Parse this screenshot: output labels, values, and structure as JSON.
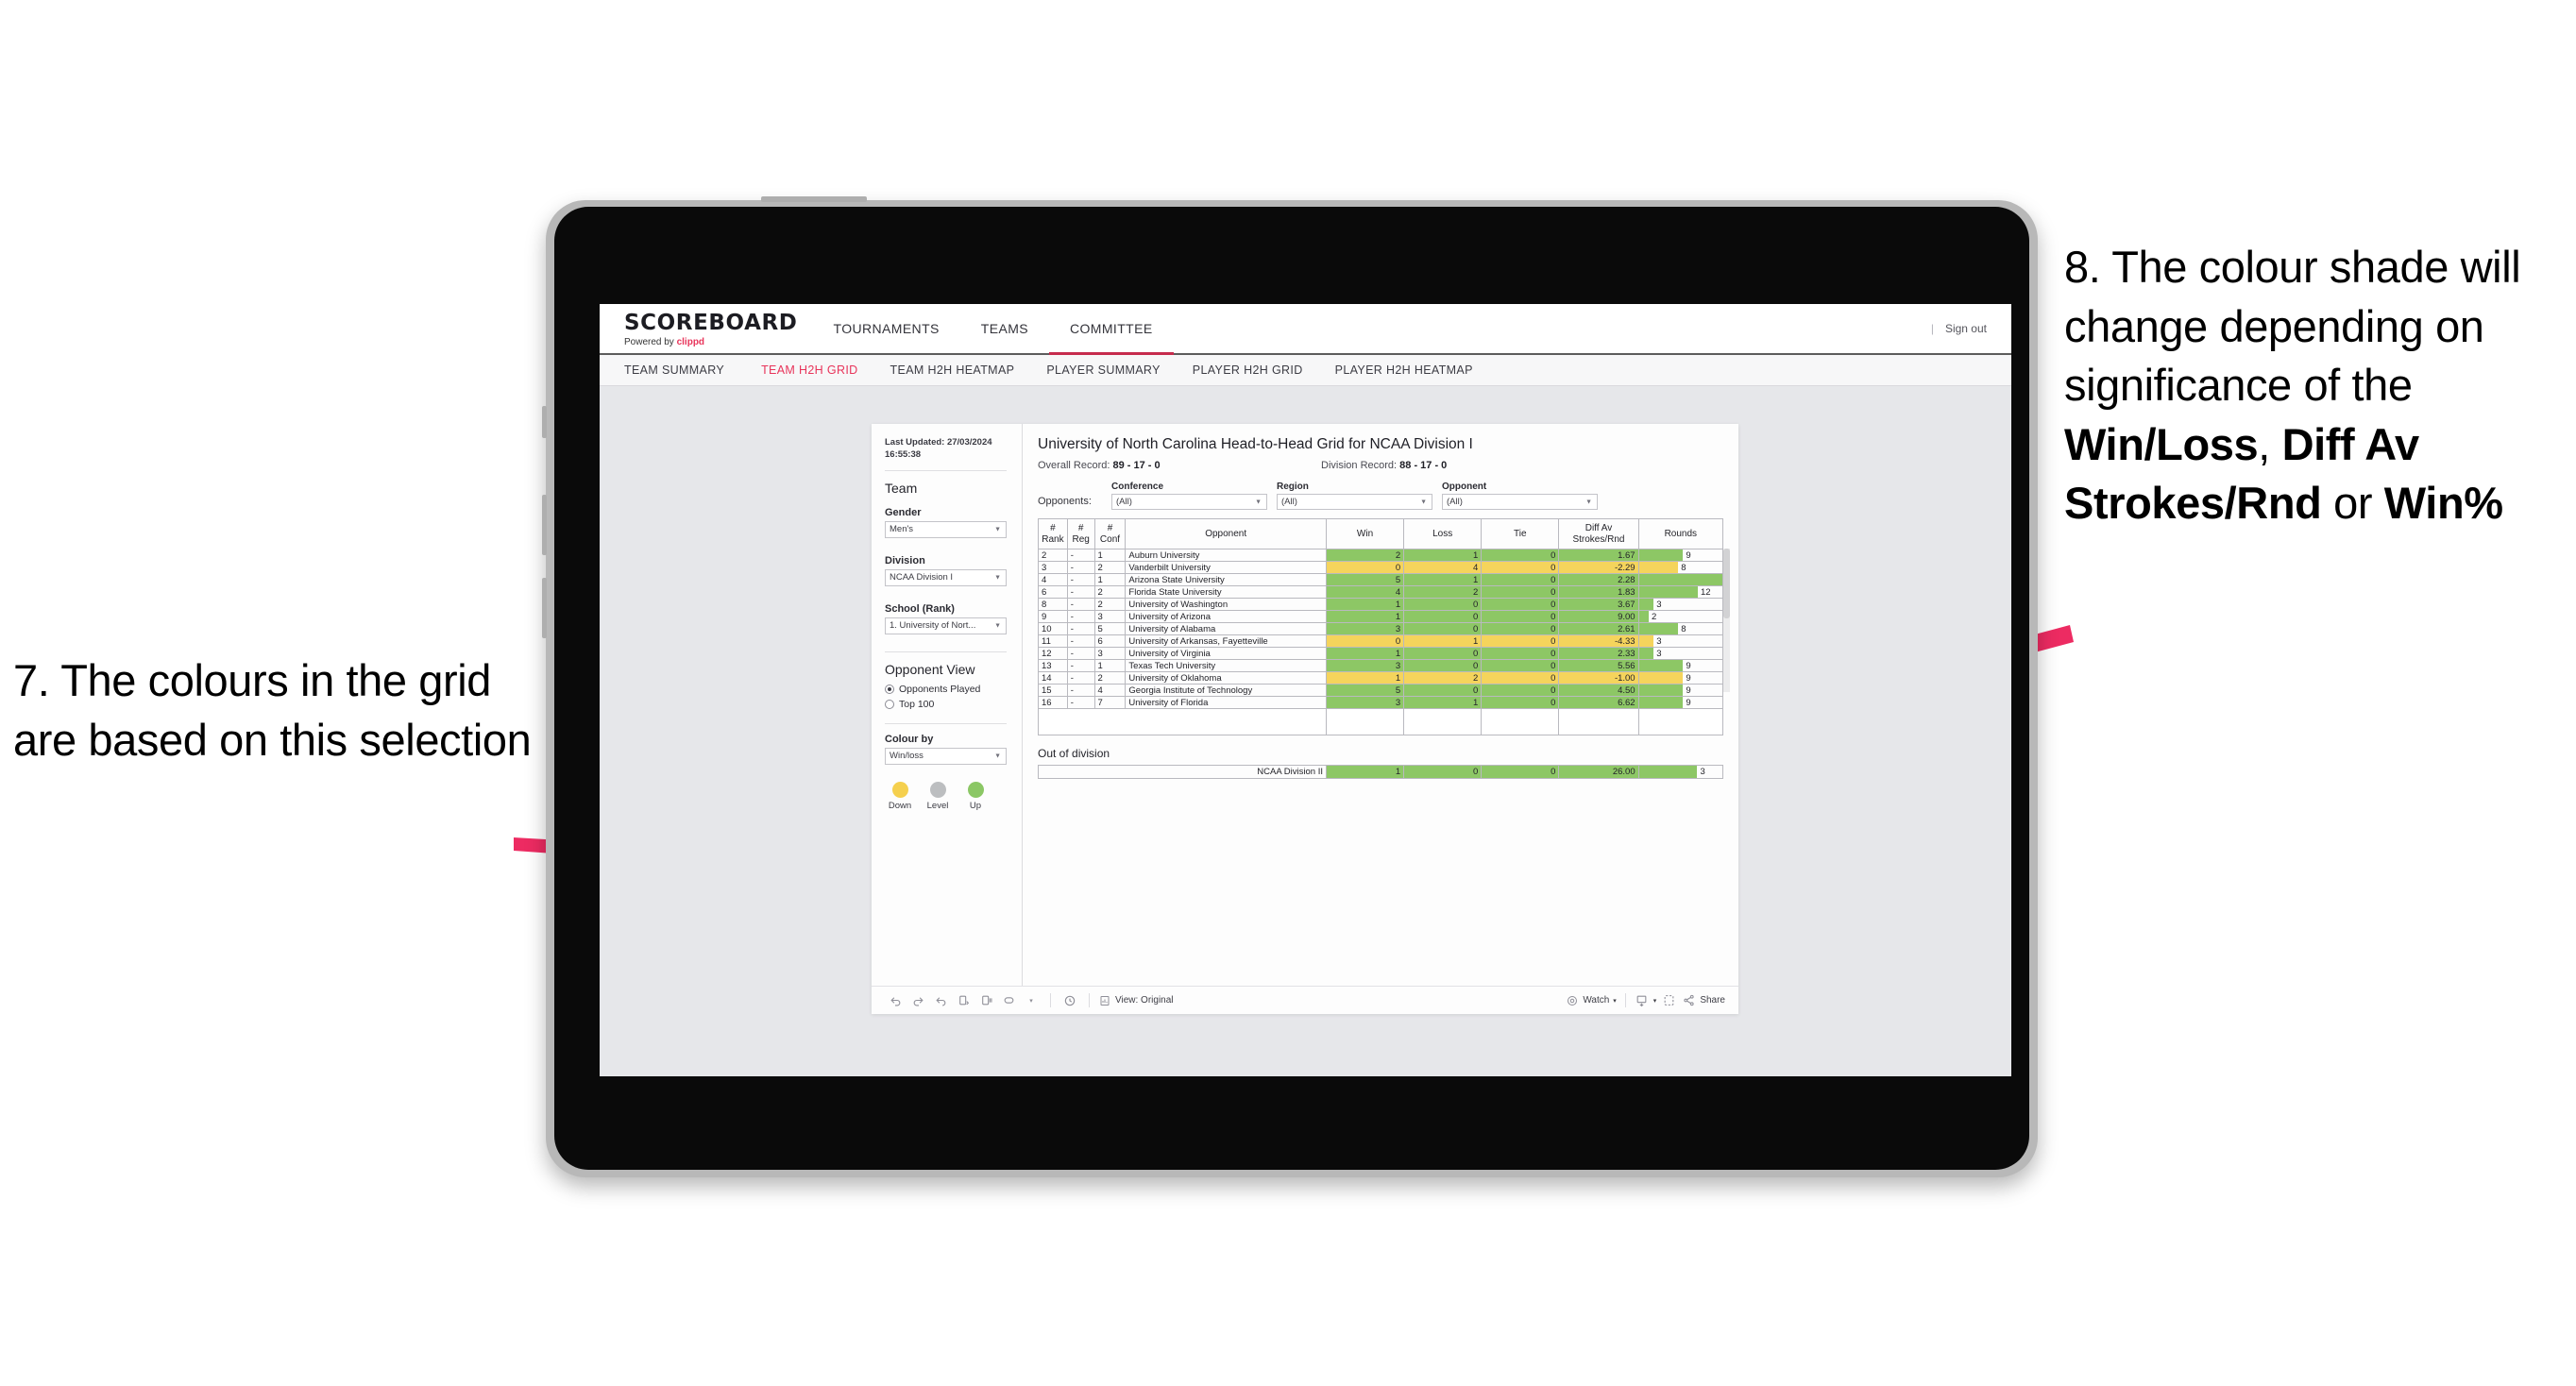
{
  "annotations": {
    "left": {
      "number": "7.",
      "text": "7. The colours in the grid are based on this selection"
    },
    "right": {
      "segments": [
        {
          "text": "8. The colour shade will change depending on significance of the ",
          "bold": false
        },
        {
          "text": "Win/Loss",
          "bold": true
        },
        {
          "text": ", ",
          "bold": false
        },
        {
          "text": "Diff Av Strokes/Rnd",
          "bold": true
        },
        {
          "text": " or ",
          "bold": false
        },
        {
          "text": "Win%",
          "bold": true
        }
      ]
    },
    "arrow_color": "#ED2B62"
  },
  "navbar": {
    "brand_title": "SCOREBOARD",
    "brand_powered": "Powered by",
    "brand_name": "clippd",
    "tabs": [
      {
        "label": "TOURNAMENTS",
        "active": false
      },
      {
        "label": "TEAMS",
        "active": false
      },
      {
        "label": "COMMITTEE",
        "active": true
      }
    ],
    "separator": "|",
    "sign_out": "Sign out"
  },
  "subnav": {
    "tabs": [
      {
        "label": "TEAM SUMMARY",
        "active": false
      },
      {
        "label": "TEAM H2H GRID",
        "active": true
      },
      {
        "label": "TEAM H2H HEATMAP",
        "active": false
      },
      {
        "label": "PLAYER SUMMARY",
        "active": false
      },
      {
        "label": "PLAYER H2H GRID",
        "active": false
      },
      {
        "label": "PLAYER H2H HEATMAP",
        "active": false
      }
    ],
    "active_color": "#E8345A"
  },
  "filters": {
    "last_updated": "Last Updated: 27/03/2024 16:55:38",
    "team_heading": "Team",
    "gender": {
      "label": "Gender",
      "value": "Men's"
    },
    "division": {
      "label": "Division",
      "value": "NCAA Division I"
    },
    "school": {
      "label": "School (Rank)",
      "value": "1. University of Nort..."
    },
    "opponent_view": {
      "heading": "Opponent View",
      "options": [
        {
          "label": "Opponents Played",
          "selected": true
        },
        {
          "label": "Top 100",
          "selected": false
        }
      ]
    },
    "colour_by": {
      "label": "Colour by",
      "value": "Win/loss"
    },
    "legend": [
      {
        "label": "Down",
        "color": "#F5D04E"
      },
      {
        "label": "Level",
        "color": "#BCBEC0"
      },
      {
        "label": "Up",
        "color": "#8BC765"
      }
    ]
  },
  "viz": {
    "title": "University of North Carolina Head-to-Head Grid for NCAA Division I",
    "overall_record_label": "Overall Record:",
    "overall_record": "89 - 17 - 0",
    "division_record_label": "Division Record:",
    "division_record": "88 - 17 - 0",
    "opponents_label": "Opponents:",
    "opponent_filters": [
      {
        "label": "Conference",
        "value": "(All)"
      },
      {
        "label": "Region",
        "value": "(All)"
      },
      {
        "label": "Opponent",
        "value": "(All)"
      }
    ]
  },
  "chart_data": {
    "type": "table",
    "title": "University of North Carolina Head-to-Head Grid for NCAA Division I",
    "columns": [
      "# Rank",
      "# Reg",
      "# Conf",
      "Opponent",
      "Win",
      "Loss",
      "Tie",
      "Diff Av Strokes/Rnd",
      "Rounds"
    ],
    "column_headers_wrapped": [
      {
        "line1": "#",
        "line2": "Rank"
      },
      {
        "line1": "#",
        "line2": "Reg"
      },
      {
        "line1": "#",
        "line2": "Conf"
      },
      {
        "line1": "",
        "line2": "Opponent"
      },
      {
        "line1": "",
        "line2": "Win"
      },
      {
        "line1": "",
        "line2": "Loss"
      },
      {
        "line1": "",
        "line2": "Tie"
      },
      {
        "line1": "Diff Av",
        "line2": "Strokes/Rnd"
      },
      {
        "line1": "",
        "line2": "Rounds"
      }
    ],
    "rounds_max": 17,
    "colors": {
      "up": "#8DC765",
      "down": "#F5D45C"
    },
    "rows": [
      {
        "rank": "2",
        "reg": "-",
        "conf": "1",
        "opponent": "Auburn University",
        "win": "2",
        "loss": "1",
        "tie": "0",
        "diff": "1.67",
        "rounds": "9",
        "state": "green"
      },
      {
        "rank": "3",
        "reg": "-",
        "conf": "2",
        "opponent": "Vanderbilt University",
        "win": "0",
        "loss": "4",
        "tie": "0",
        "diff": "-2.29",
        "rounds": "8",
        "state": "yellow"
      },
      {
        "rank": "4",
        "reg": "-",
        "conf": "1",
        "opponent": "Arizona State University",
        "win": "5",
        "loss": "1",
        "tie": "0",
        "diff": "2.28",
        "rounds": "17",
        "state": "green"
      },
      {
        "rank": "6",
        "reg": "-",
        "conf": "2",
        "opponent": "Florida State University",
        "win": "4",
        "loss": "2",
        "tie": "0",
        "diff": "1.83",
        "rounds": "12",
        "state": "green"
      },
      {
        "rank": "8",
        "reg": "-",
        "conf": "2",
        "opponent": "University of Washington",
        "win": "1",
        "loss": "0",
        "tie": "0",
        "diff": "3.67",
        "rounds": "3",
        "state": "green"
      },
      {
        "rank": "9",
        "reg": "-",
        "conf": "3",
        "opponent": "University of Arizona",
        "win": "1",
        "loss": "0",
        "tie": "0",
        "diff": "9.00",
        "rounds": "2",
        "state": "green"
      },
      {
        "rank": "10",
        "reg": "-",
        "conf": "5",
        "opponent": "University of Alabama",
        "win": "3",
        "loss": "0",
        "tie": "0",
        "diff": "2.61",
        "rounds": "8",
        "state": "green"
      },
      {
        "rank": "11",
        "reg": "-",
        "conf": "6",
        "opponent": "University of Arkansas, Fayetteville",
        "win": "0",
        "loss": "1",
        "tie": "0",
        "diff": "-4.33",
        "rounds": "3",
        "state": "yellow"
      },
      {
        "rank": "12",
        "reg": "-",
        "conf": "3",
        "opponent": "University of Virginia",
        "win": "1",
        "loss": "0",
        "tie": "0",
        "diff": "2.33",
        "rounds": "3",
        "state": "green"
      },
      {
        "rank": "13",
        "reg": "-",
        "conf": "1",
        "opponent": "Texas Tech University",
        "win": "3",
        "loss": "0",
        "tie": "0",
        "diff": "5.56",
        "rounds": "9",
        "state": "green"
      },
      {
        "rank": "14",
        "reg": "-",
        "conf": "2",
        "opponent": "University of Oklahoma",
        "win": "1",
        "loss": "2",
        "tie": "0",
        "diff": "-1.00",
        "rounds": "9",
        "state": "yellow"
      },
      {
        "rank": "15",
        "reg": "-",
        "conf": "4",
        "opponent": "Georgia Institute of Technology",
        "win": "5",
        "loss": "0",
        "tie": "0",
        "diff": "4.50",
        "rounds": "9",
        "state": "green"
      },
      {
        "rank": "16",
        "reg": "-",
        "conf": "7",
        "opponent": "University of Florida",
        "win": "3",
        "loss": "1",
        "tie": "0",
        "diff": "6.62",
        "rounds": "9",
        "state": "green"
      }
    ],
    "out_of_division": {
      "title": "Out of division",
      "row": {
        "label": "NCAA Division II",
        "win": "1",
        "loss": "0",
        "tie": "0",
        "diff": "26.00",
        "rounds": "3",
        "state": "green"
      }
    }
  },
  "toolbar": {
    "view_label": "View: Original",
    "watch_label": "Watch",
    "share_label": "Share",
    "caret": "▾",
    "icons": [
      "undo-icon",
      "redo-icon",
      "revert-icon",
      "refresh-icon",
      "pause-icon",
      "alerts-icon",
      "dashboard-icon",
      "watch-icon",
      "download-icon",
      "fullscreen-icon",
      "share-icon"
    ]
  }
}
